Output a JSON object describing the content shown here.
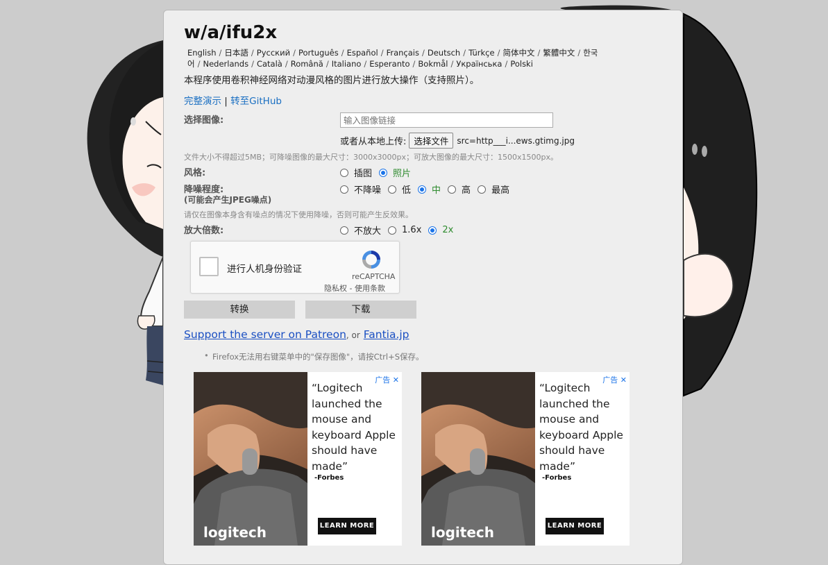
{
  "app": {
    "logo_text": "w/a/ifu2x"
  },
  "languages": [
    "English",
    "日本語",
    "Русский",
    "Português",
    "Español",
    "Français",
    "Deutsch",
    "Türkçe",
    "简体中文",
    "繁體中文",
    "한국어",
    "Nederlands",
    "Català",
    "Română",
    "Italiano",
    "Esperanto",
    "Bokmål",
    "Українська",
    "Polski"
  ],
  "description": "本程序使用卷积神经网络对动漫风格的图片进行放大操作（支持照片）。",
  "links": {
    "demo": "完整演示",
    "separator": "|",
    "github": "转至GitHub"
  },
  "form": {
    "image_label": "选择图像:",
    "url_placeholder": "输入图像链接",
    "upload_label": "或者从本地上传:",
    "file_button": "选择文件",
    "file_name": "src=http___i...ews.gtimg.jpg",
    "size_note": "文件大小不得超过5MB；可降噪图像的最大尺寸：3000x3000px；可放大图像的最大尺寸：1500x1500px。",
    "style_label": "风格:",
    "style_options": [
      {
        "label": "插图",
        "selected": false
      },
      {
        "label": "照片",
        "selected": true
      }
    ],
    "noise_label": "降噪程度:",
    "noise_sublabel": "(可能会产生JPEG噪点)",
    "noise_options": [
      {
        "label": "不降噪",
        "selected": false
      },
      {
        "label": "低",
        "selected": false
      },
      {
        "label": "中",
        "selected": true
      },
      {
        "label": "高",
        "selected": false
      },
      {
        "label": "最高",
        "selected": false
      }
    ],
    "noise_note": "请仅在图像本身含有噪点的情况下使用降噪，否则可能产生反效果。",
    "scale_label": "放大倍数:",
    "scale_options": [
      {
        "label": "不放大",
        "selected": false
      },
      {
        "label": "1.6x",
        "selected": false
      },
      {
        "label": "2x",
        "selected": true
      }
    ]
  },
  "captcha": {
    "label": "进行人机身份验证",
    "brand": "reCAPTCHA",
    "terms": "隐私权 - 使用条款"
  },
  "buttons": {
    "convert": "转换",
    "download": "下载"
  },
  "support": {
    "patreon": "Support the server on Patreon",
    "or": ", or",
    "fantia": "Fantia.jp"
  },
  "tip": "Firefox无法用右键菜单中的\"保存图像\"，请按Ctrl+S保存。",
  "ads": [
    {
      "adchoice": "广告",
      "quote": "“Logitech launched the mouse and keyboard Apple should have made”",
      "source": "-Forbes",
      "cta": "LEARN MORE",
      "brand": "logitech"
    },
    {
      "adchoice": "广告",
      "quote": "“Logitech launched the mouse and keyboard Apple should have made”",
      "source": "-Forbes",
      "cta": "LEARN MORE",
      "brand": "logitech"
    }
  ],
  "colors": {
    "background": "#cccccc",
    "panel": "#eeeeee",
    "link": "#1a6fc2",
    "selected_option": "#2e8b2e",
    "radio_accent": "#1a73e8"
  }
}
